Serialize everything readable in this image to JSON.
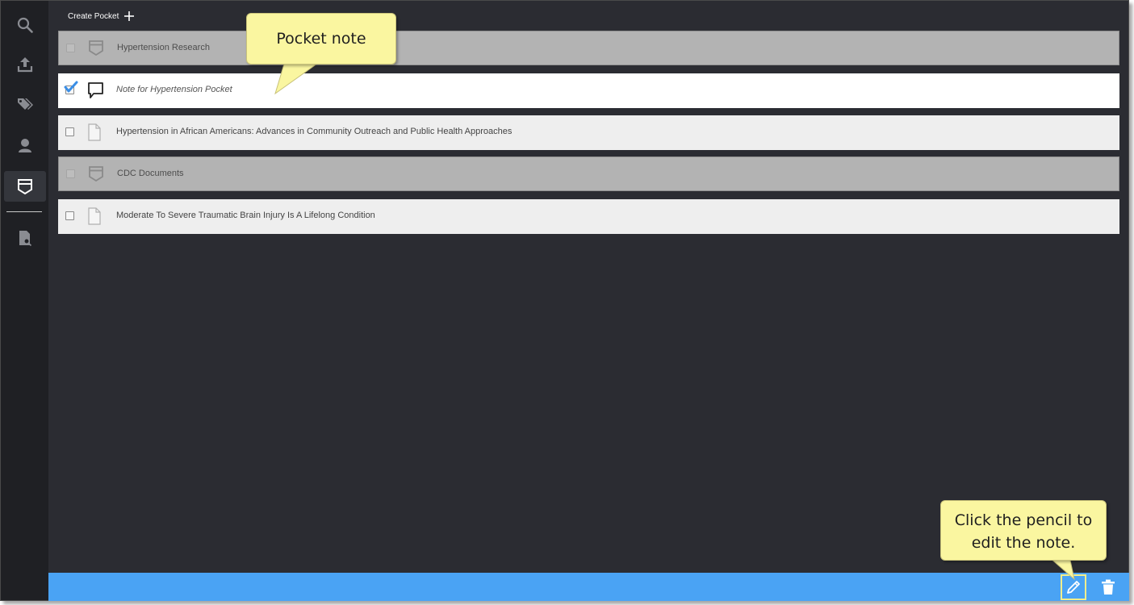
{
  "toolbar": {
    "create_label": "Create Pocket"
  },
  "sidebar": {
    "items": [
      {
        "icon": "search-icon"
      },
      {
        "icon": "upload-icon"
      },
      {
        "icon": "tags-icon"
      },
      {
        "icon": "user-icon"
      },
      {
        "icon": "pocket-icon",
        "active": true
      },
      {
        "icon": "document-search-icon"
      }
    ]
  },
  "rows": [
    {
      "type": "pocket",
      "label": "Hypertension Research",
      "checked": false
    },
    {
      "type": "note",
      "label": "Note for Hypertension Pocket",
      "checked": true
    },
    {
      "type": "document",
      "label": "Hypertension in African Americans: Advances in Community Outreach and Public Health Approaches",
      "checked": false
    },
    {
      "type": "pocket",
      "label": "CDC Documents",
      "checked": false
    },
    {
      "type": "document",
      "label": "Moderate To Severe Traumatic Brain Injury Is A Lifelong Condition",
      "checked": false
    }
  ],
  "callouts": {
    "pocket_note": "Pocket note",
    "edit_line1": "Click the pencil to",
    "edit_line2": "edit the note."
  },
  "actions": {
    "edit": "pencil-icon",
    "delete": "trash-icon"
  },
  "colors": {
    "accent": "#4aa3f4",
    "callout": "#faf6a0",
    "background": "#2b2c32"
  }
}
